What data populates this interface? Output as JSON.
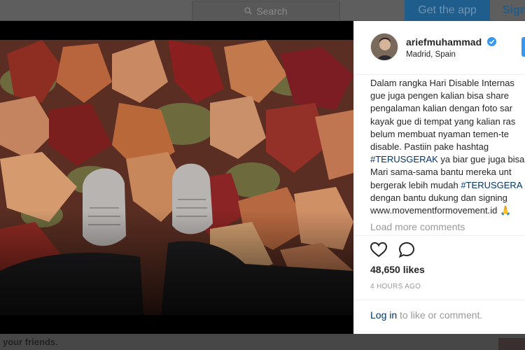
{
  "header": {
    "search_placeholder": "Search",
    "get_app_label": "Get the app",
    "signup_label": "Sign"
  },
  "background_page": {
    "bottom_text": "your friends."
  },
  "post": {
    "username": "ariefmuhammad",
    "location": "Madrid, Spain",
    "caption_lines": [
      {
        "text": "Dalam rangka Hari Disable Internas",
        "tag": ""
      },
      {
        "text": "gue juga pengen kalian bisa share",
        "tag": ""
      },
      {
        "text": "pengalaman kalian dengan foto sar",
        "tag": ""
      },
      {
        "text": "kayak gue di tempat yang kalian ras",
        "tag": ""
      },
      {
        "text": "belum membuat nyaman temen-te",
        "tag": ""
      },
      {
        "text": "disable. Pastiin pake hashtag",
        "tag": ""
      },
      {
        "text": " ya biar gue juga bisa",
        "tag": "#TERUSGERAK"
      },
      {
        "text": "Mari sama-sama bantu mereka unt",
        "tag": ""
      },
      {
        "text": "bergerak lebih mudah ",
        "tag_after": "#TERUSGERA"
      },
      {
        "text": "dengan bantu dukung dan signing",
        "tag": ""
      },
      {
        "text": "www.movementformovement.id 🙏",
        "tag": ""
      }
    ],
    "load_more_label": "Load more comments",
    "likes": "48,650 likes",
    "time_ago": "4 HOURS AGO",
    "login_prompt": {
      "link": "Log in",
      "rest": " to like or comment."
    }
  },
  "icons": {
    "like": "heart-outline-icon",
    "comment": "speech-bubble-icon",
    "verified": "verified-badge-icon",
    "search": "magnifier-icon"
  },
  "colors": {
    "link": "#003569",
    "verified": "#3897f0",
    "muted": "#999999",
    "text": "#262626"
  }
}
